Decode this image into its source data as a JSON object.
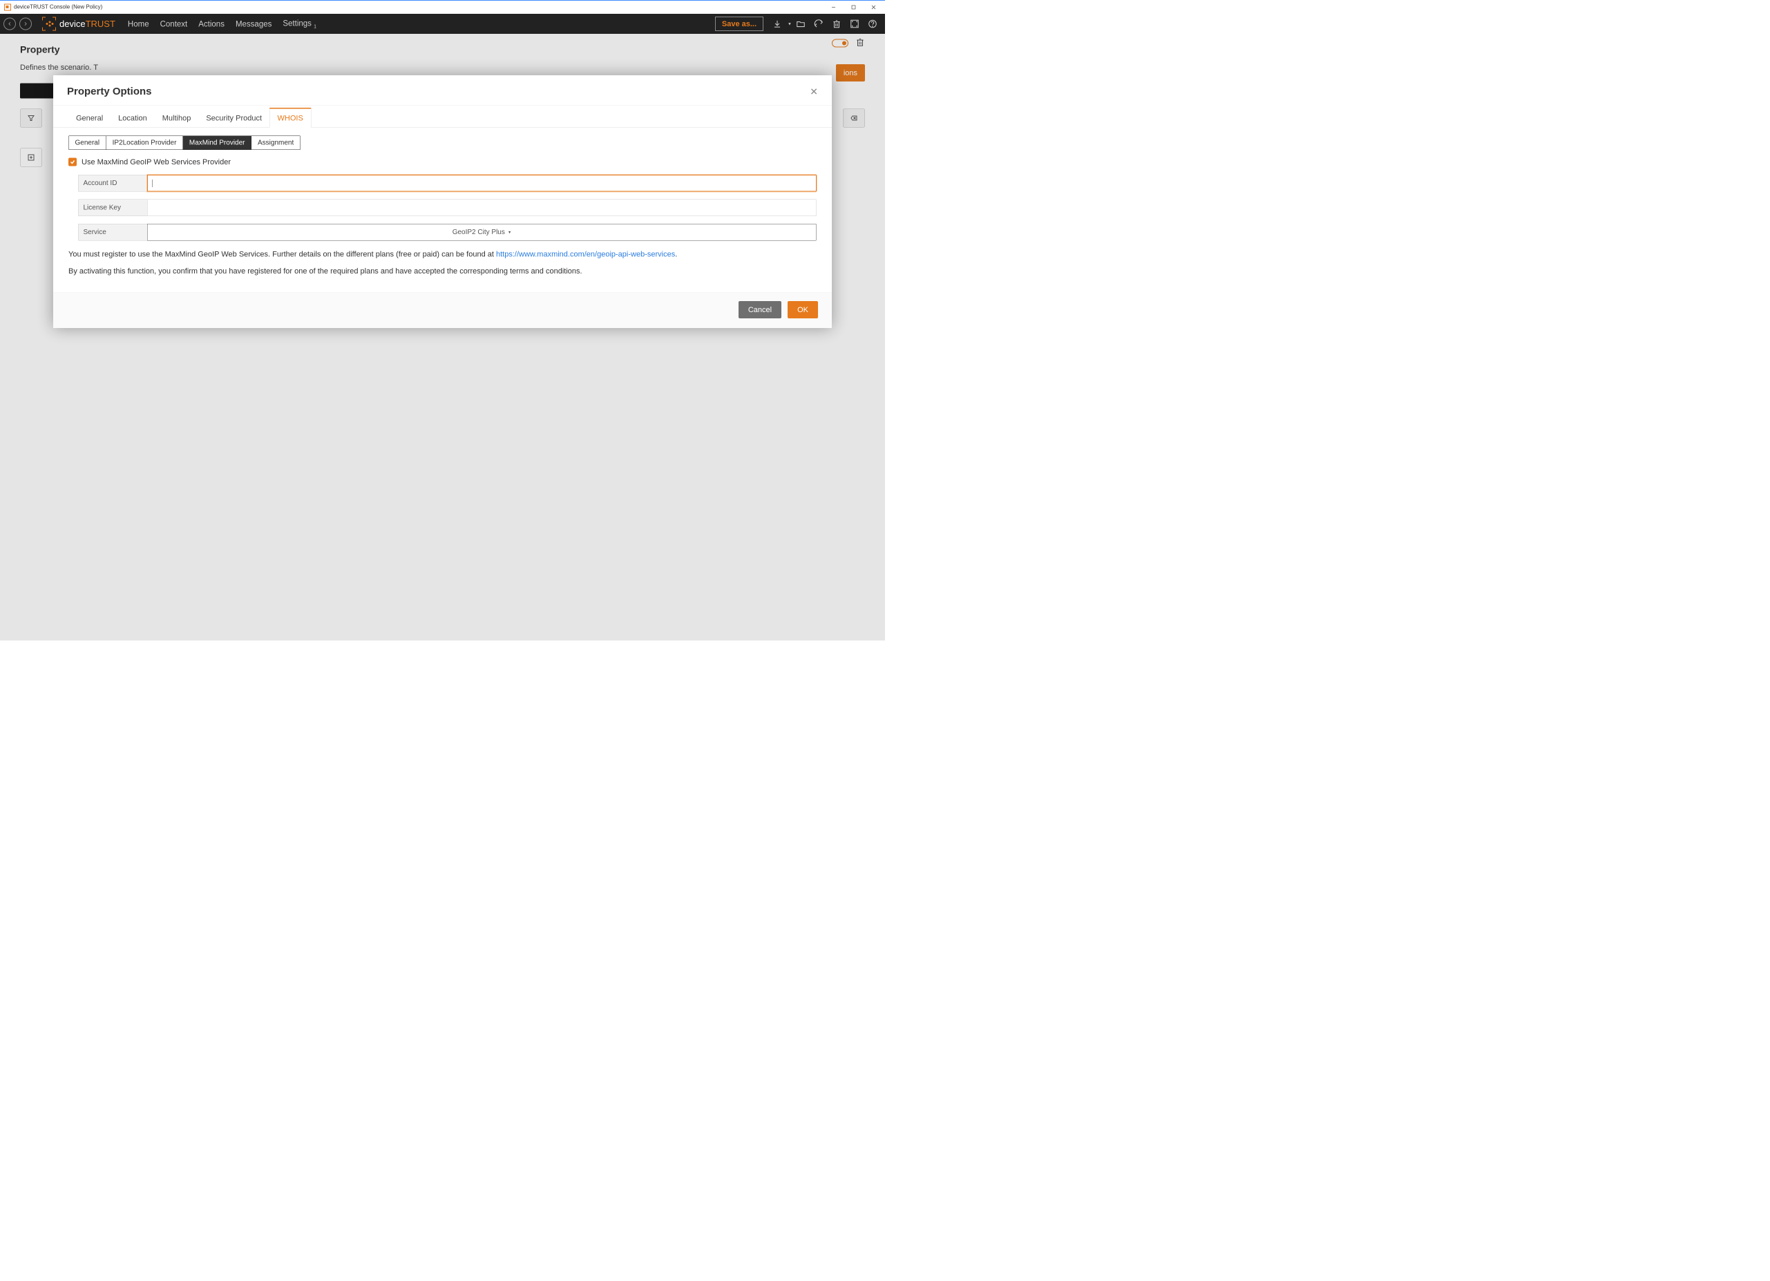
{
  "window": {
    "title": "deviceTRUST Console (New Policy)"
  },
  "brand": {
    "prefix": "device",
    "suffix": "TRUST"
  },
  "menu": {
    "home": "Home",
    "context": "Context",
    "actions": "Actions",
    "messages": "Messages",
    "settings": "Settings",
    "settings_badge": "1"
  },
  "toolbar": {
    "save_as": "Save as..."
  },
  "bg": {
    "title": "Property",
    "desc": "Defines the scenario. T",
    "options_btn": "ions"
  },
  "dialog": {
    "title": "Property Options",
    "tabs": {
      "general": "General",
      "location": "Location",
      "multihop": "Multihop",
      "security": "Security Product",
      "whois": "WHOIS"
    },
    "subtabs": {
      "general": "General",
      "ip2loc": "IP2Location Provider",
      "maxmind": "MaxMind Provider",
      "assignment": "Assignment"
    },
    "checkbox_label": "Use MaxMind GeoIP Web Services Provider",
    "fields": {
      "account_id_label": "Account ID",
      "account_id_value": "",
      "license_key_label": "License Key",
      "license_key_value": "",
      "service_label": "Service",
      "service_value": "GeoIP2 City Plus"
    },
    "info1_pre": "You must register to use the MaxMind GeoIP Web Services. Further details on the different plans (free or paid) can be found at ",
    "info1_link": "https://www.maxmind.com/en/geoip-api-web-services",
    "info1_post": ".",
    "info2": "By activating this function, you confirm that you have registered for one of the required plans and have accepted the corresponding terms and conditions.",
    "cancel": "Cancel",
    "ok": "OK"
  }
}
